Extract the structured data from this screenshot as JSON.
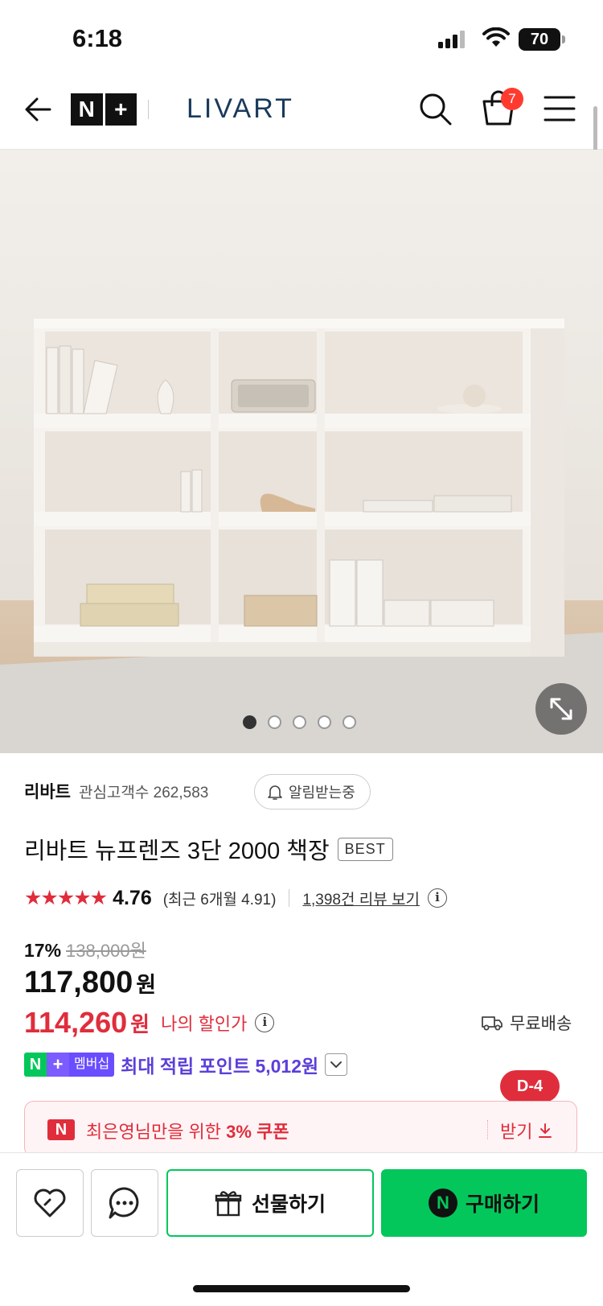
{
  "status_bar": {
    "time": "6:18",
    "battery": "70"
  },
  "header": {
    "nplus_n": "N",
    "nplus_plus": "+",
    "brand": "LIVART",
    "cart_count": "7"
  },
  "gallery": {
    "total_slides": 5,
    "active_index": 0
  },
  "store": {
    "name": "리바트",
    "followers_label": "관심고객수 262,583",
    "alarm_label": "알림받는중"
  },
  "product": {
    "title": "리바트 뉴프렌즈 3단 2000 책장",
    "badge": "BEST",
    "stars": "★★★★★",
    "rating": "4.76",
    "recent_rating": "(최근 6개월 4.91)",
    "reviews_link": "1,398건 리뷰 보기",
    "info_glyph": "i"
  },
  "pricing": {
    "discount_rate": "17%",
    "original_price": "138,000원",
    "price": "117,800",
    "price_unit": "원",
    "my_price": "114,260",
    "my_price_unit": "원",
    "my_price_label": "나의 할인가",
    "shipping": "무료배송"
  },
  "membership": {
    "badge_n": "N",
    "badge_plus": "+",
    "badge_label": "멤버십",
    "text": "최대 적립 포인트 5,012원"
  },
  "coupon": {
    "icon": "N",
    "text_prefix": "최은영님만을 위한 ",
    "text_emphasis": "3% 쿠폰",
    "get_label": "받기",
    "dday": "D-4"
  },
  "bottom_bar": {
    "gift_label": "선물하기",
    "buy_icon": "N",
    "buy_label": "구매하기"
  },
  "colors": {
    "accent_red": "#e02d3c",
    "naver_green": "#03c75a",
    "membership_purple": "#5b3fd9",
    "brand_navy": "#1a3a5c"
  }
}
